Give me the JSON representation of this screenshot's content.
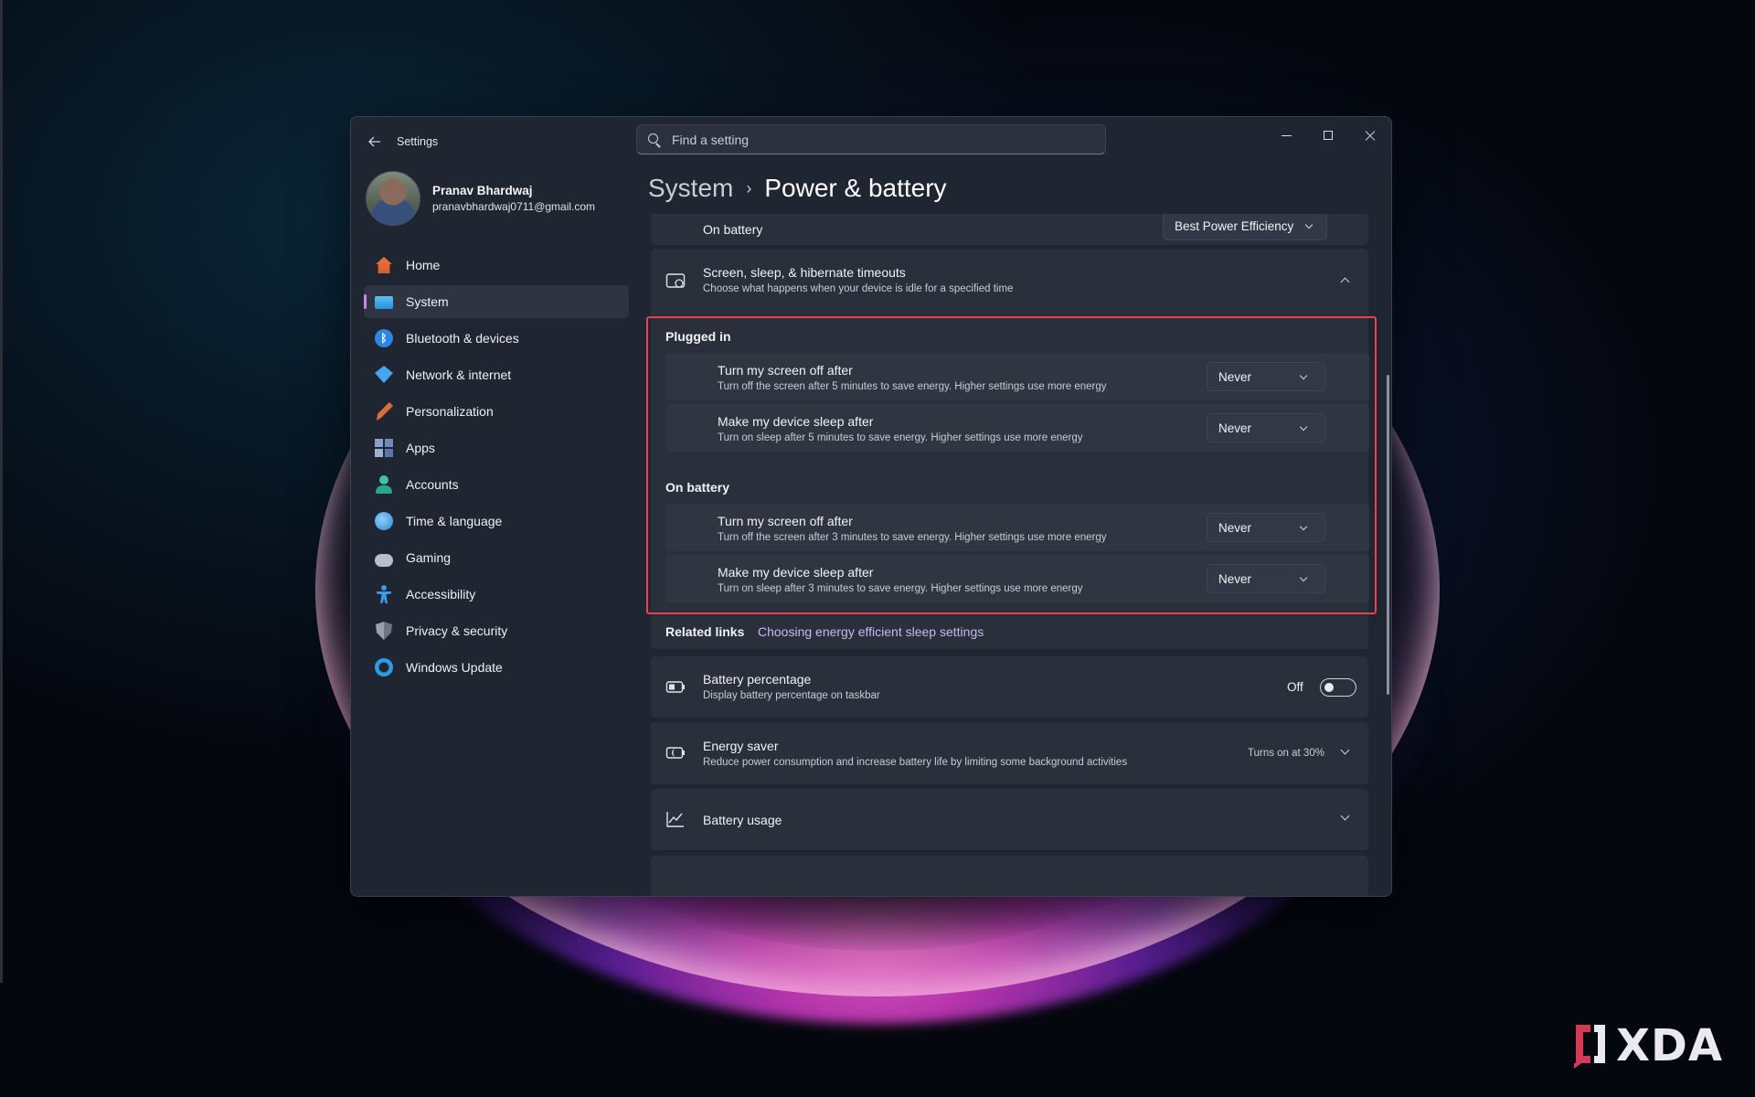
{
  "window": {
    "app_title": "Settings",
    "search_placeholder": "Find a setting"
  },
  "profile": {
    "name": "Pranav Bhardwaj",
    "email": "pranavbhardwaj0711@gmail.com"
  },
  "sidebar": {
    "items": [
      {
        "label": "Home",
        "icon": "home-icon"
      },
      {
        "label": "System",
        "icon": "system-icon",
        "active": true
      },
      {
        "label": "Bluetooth & devices",
        "icon": "bluetooth-icon"
      },
      {
        "label": "Network & internet",
        "icon": "network-icon"
      },
      {
        "label": "Personalization",
        "icon": "brush-icon"
      },
      {
        "label": "Apps",
        "icon": "apps-icon"
      },
      {
        "label": "Accounts",
        "icon": "accounts-icon"
      },
      {
        "label": "Time & language",
        "icon": "globe-clock-icon"
      },
      {
        "label": "Gaming",
        "icon": "gamepad-icon"
      },
      {
        "label": "Accessibility",
        "icon": "accessibility-icon"
      },
      {
        "label": "Privacy & security",
        "icon": "shield-icon"
      },
      {
        "label": "Windows Update",
        "icon": "update-icon"
      }
    ]
  },
  "breadcrumb": {
    "parent": "System",
    "separator": "›",
    "current": "Power & battery"
  },
  "power_mode": {
    "label": "On battery",
    "value": "Best Power Efficiency"
  },
  "timeouts": {
    "title": "Screen, sleep, & hibernate timeouts",
    "subtitle": "Choose what happens when your device is idle for a specified time",
    "plugged_in": {
      "label": "Plugged in",
      "screen_off": {
        "title": "Turn my screen off after",
        "subtitle": "Turn off the screen after 5 minutes to save energy. Higher settings use more energy",
        "value": "Never"
      },
      "sleep": {
        "title": "Make my device sleep after",
        "subtitle": "Turn on sleep after 5 minutes to save energy. Higher settings use more energy",
        "value": "Never"
      }
    },
    "on_battery": {
      "label": "On battery",
      "screen_off": {
        "title": "Turn my screen off after",
        "subtitle": "Turn off the screen after 3 minutes to save energy. Higher settings use more energy",
        "value": "Never"
      },
      "sleep": {
        "title": "Make my device sleep after",
        "subtitle": "Turn on sleep after 3 minutes to save energy. Higher settings use more energy",
        "value": "Never"
      }
    }
  },
  "related_links": {
    "label": "Related links",
    "link": "Choosing energy efficient sleep settings"
  },
  "battery_percentage": {
    "title": "Battery percentage",
    "subtitle": "Display battery percentage on taskbar",
    "state": "Off"
  },
  "energy_saver": {
    "title": "Energy saver",
    "subtitle": "Reduce power consumption and increase battery life by limiting some background activities",
    "status": "Turns on at 30%"
  },
  "battery_usage": {
    "title": "Battery usage"
  },
  "watermark": {
    "text": "XDA"
  },
  "colors": {
    "accent": "#c38de0",
    "highlight_border": "#e8414f",
    "window_bg": "#1f2531",
    "card_bg": "#2a303b"
  }
}
